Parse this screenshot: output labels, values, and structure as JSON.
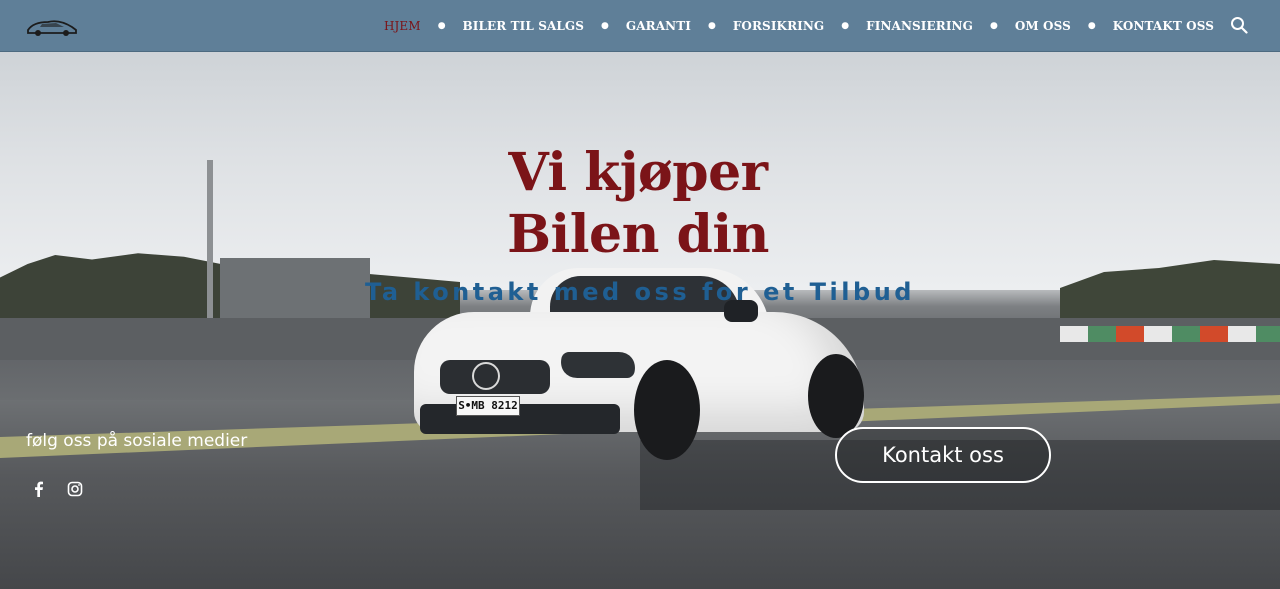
{
  "header": {
    "logo_icon": "car-logo-icon",
    "nav": [
      {
        "label": "HJEM",
        "active": true
      },
      {
        "label": "BILER TIL SALGS",
        "active": false
      },
      {
        "label": "GARANTI",
        "active": false
      },
      {
        "label": "FORSIKRING",
        "active": false
      },
      {
        "label": "FINANSIERING",
        "active": false
      },
      {
        "label": "OM OSS",
        "active": false
      },
      {
        "label": "KONTAKT OSS",
        "active": false
      }
    ],
    "search_icon": "search-icon",
    "bg_color": "#5f7f98",
    "active_color": "#7b1418"
  },
  "hero": {
    "headline_line1": "Vi kjøper",
    "headline_line2": "Bilen din",
    "subheading": "Ta kontakt med oss for et Tilbud",
    "plate": "S•MB 8212",
    "social_text": "følg oss på sosiale medier",
    "social_icons": [
      "facebook-icon",
      "instagram-icon"
    ],
    "cta_label": "Kontakt oss",
    "headline_color": "#7b1418",
    "sub_color": "#1f5f93"
  }
}
